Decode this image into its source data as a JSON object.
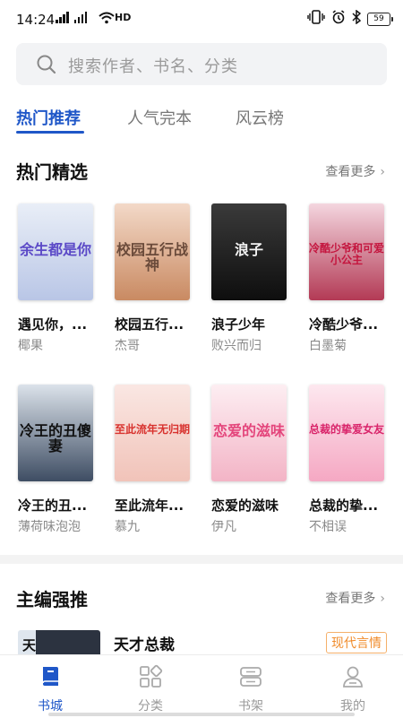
{
  "status_bar": {
    "time": "14:24",
    "network": "HD",
    "battery": "59"
  },
  "search": {
    "placeholder": "搜索作者、书名、分类"
  },
  "tabs": [
    {
      "label": "热门推荐",
      "active": true
    },
    {
      "label": "人气完本",
      "active": false
    },
    {
      "label": "风云榜",
      "active": false
    }
  ],
  "hot": {
    "title": "热门精选",
    "more": "查看更多",
    "books": [
      {
        "title": "遇见你，...",
        "author": "椰果",
        "cover_text": "余生都是你",
        "cover_top": "#e9eef7",
        "cover_bottom": "#b9c6e6",
        "cover_text_color": "#5b49c7"
      },
      {
        "title": "校园五行...",
        "author": "杰哥",
        "cover_text": "校园五行战神",
        "cover_top": "#f3d9c8",
        "cover_bottom": "#c98a62",
        "cover_text_color": "#6a4a3a"
      },
      {
        "title": "浪子少年",
        "author": "败兴而归",
        "cover_text": "浪子",
        "cover_top": "#3a3a3a",
        "cover_bottom": "#0e0e0e",
        "cover_text_color": "#f2f2f2"
      },
      {
        "title": "冷酷少爷...",
        "author": "白墨菊",
        "cover_text": "冷酷少爷和可爱小公主",
        "cover_top": "#f4d6df",
        "cover_bottom": "#b33a55",
        "cover_text_color": "#c4153e"
      },
      {
        "title": "冷王的丑...",
        "author": "薄荷味泡泡",
        "cover_text": "冷王的丑傻妻",
        "cover_top": "#dbe2ea",
        "cover_bottom": "#3e4d63",
        "cover_text_color": "#111111"
      },
      {
        "title": "至此流年...",
        "author": "慕九",
        "cover_text": "至此流年无归期",
        "cover_top": "#fae7e3",
        "cover_bottom": "#f1c3b9",
        "cover_text_color": "#d8322e"
      },
      {
        "title": "恋爱的滋味",
        "author": "伊凡",
        "cover_text": "恋爱的滋味",
        "cover_top": "#fdeef2",
        "cover_bottom": "#f3b4c6",
        "cover_text_color": "#e4467c"
      },
      {
        "title": "总裁的挚...",
        "author": "不相误",
        "cover_text": "总裁的挚爱女友",
        "cover_top": "#fde8ef",
        "cover_bottom": "#f5a8c3",
        "cover_text_color": "#d9246a"
      }
    ]
  },
  "featured": {
    "title": "主编强推",
    "more": "查看更多",
    "book_title": "天才总裁",
    "cover_text": "天",
    "tag": "现代言情"
  },
  "bottom_nav": [
    {
      "label": "书城",
      "icon": "book-icon",
      "active": true
    },
    {
      "label": "分类",
      "icon": "grid-icon",
      "active": false
    },
    {
      "label": "书架",
      "icon": "shelf-icon",
      "active": false
    },
    {
      "label": "我的",
      "icon": "user-icon",
      "active": false
    }
  ],
  "colors": {
    "accent": "#1f57c8",
    "tag": "#f08b2a"
  }
}
